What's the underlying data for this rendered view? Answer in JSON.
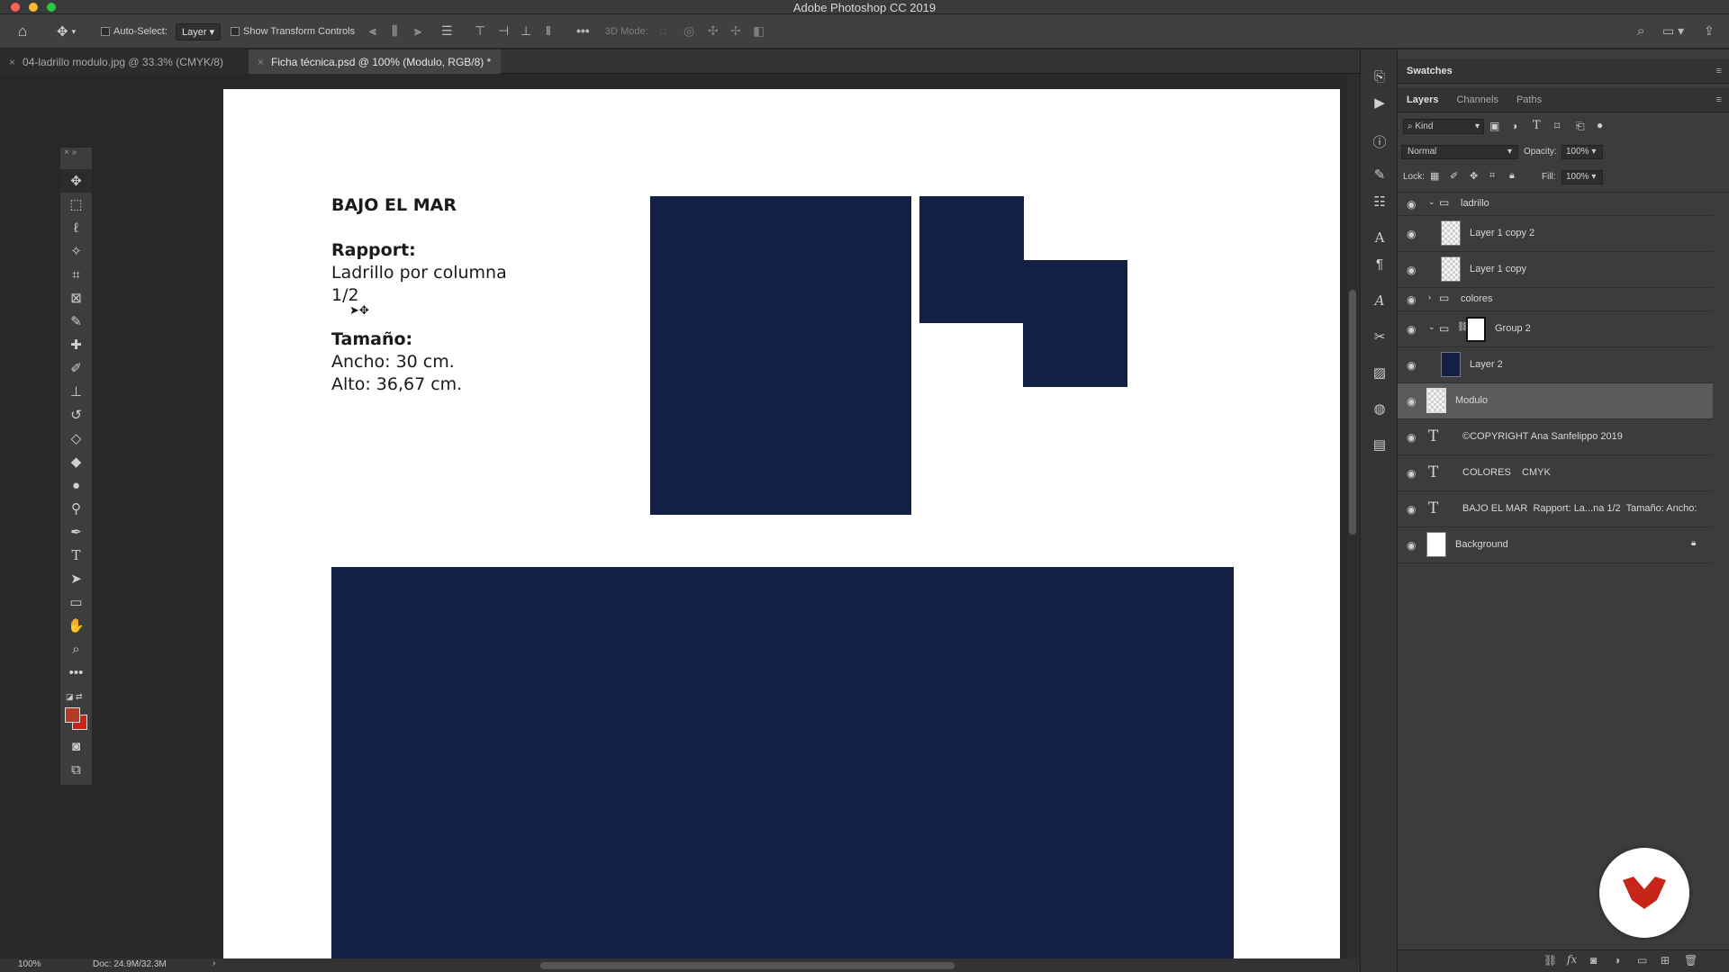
{
  "window": {
    "title": "Adobe Photoshop CC 2019"
  },
  "options_bar": {
    "auto_select_label": "Auto-Select:",
    "auto_select_value": "Layer",
    "show_transform_label": "Show Transform Controls",
    "three_d_mode_label": "3D Mode:"
  },
  "tabs": [
    {
      "label": "04-ladrillo modulo.jpg @ 33.3% (CMYK/8)",
      "active": false
    },
    {
      "label": "Ficha técnica.psd @ 100% (Modulo, RGB/8) *",
      "active": true
    }
  ],
  "document": {
    "title": "BAJO EL MAR",
    "rapport_heading": "Rapport:",
    "rapport_line1": "Ladrillo por columna",
    "rapport_line2": "1/2",
    "size_heading": "Tamaño:",
    "size_width": "Ancho: 30 cm.",
    "size_height": "Alto: 36,67 cm.",
    "fill_color": "#132046"
  },
  "status": {
    "zoom": "100%",
    "doc_size": "Doc: 24.9M/32.3M"
  },
  "swatches_panel": {
    "title": "Swatches"
  },
  "layers_panel": {
    "tabs": [
      "Layers",
      "Channels",
      "Paths"
    ],
    "filter_kind": "Kind",
    "blend_mode": "Normal",
    "opacity_label": "Opacity:",
    "opacity_value": "100%",
    "lock_label": "Lock:",
    "fill_label": "Fill:",
    "fill_value": "100%",
    "layers": [
      {
        "name": "ladrillo",
        "kind": "group-open"
      },
      {
        "name": "Layer 1 copy 2",
        "kind": "pixel"
      },
      {
        "name": "Layer 1 copy",
        "kind": "pixel"
      },
      {
        "name": "colores",
        "kind": "group-closed"
      },
      {
        "name": "Group 2",
        "kind": "group-masked"
      },
      {
        "name": "Layer 2",
        "kind": "pixel-navy"
      },
      {
        "name": "Modulo",
        "kind": "pixel-selected"
      },
      {
        "name": "©COPYRIGHT Ana Sanfelippo 2019",
        "kind": "text"
      },
      {
        "name": "COLORES    CMYK",
        "kind": "text"
      },
      {
        "name": "BAJO EL MAR  Rapport: La...na 1/2  Tamaño: Ancho:",
        "kind": "text"
      },
      {
        "name": "Background",
        "kind": "background"
      }
    ]
  },
  "colors": {
    "accent_red": "#c7241a",
    "foreground": "#b23a26",
    "background_swatch": "#c7241a"
  }
}
